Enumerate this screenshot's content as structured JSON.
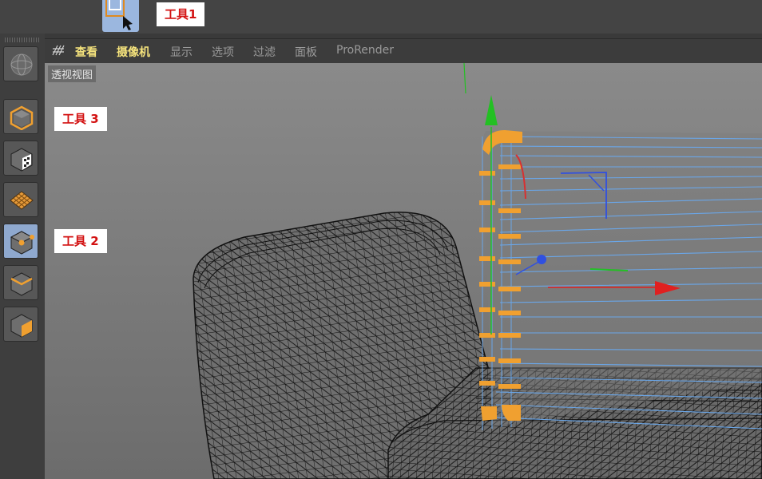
{
  "callouts": {
    "tool1": "工具1",
    "tool2": "工具 2",
    "tool3": "工具 3"
  },
  "menu": {
    "items": [
      "查看",
      "摄像机",
      "显示",
      "选项",
      "过滤",
      "面板",
      "ProRender"
    ]
  },
  "viewport": {
    "title": "透视视图"
  },
  "icons": {
    "left_toolbar": [
      "render-sphere-icon",
      "object-mode-icon",
      "texture-mode-icon",
      "polygon-mode-icon",
      "point-mode-icon",
      "edge-mode-icon",
      "face-mode-icon"
    ],
    "top_tool": "selection-tool-icon"
  },
  "colors": {
    "accent": "#f0a030",
    "active_button": "#9bb7df",
    "callout_text": "#d31212",
    "menu_highlight": "#f4e27c",
    "wire_blue": "#6aa6e8"
  }
}
